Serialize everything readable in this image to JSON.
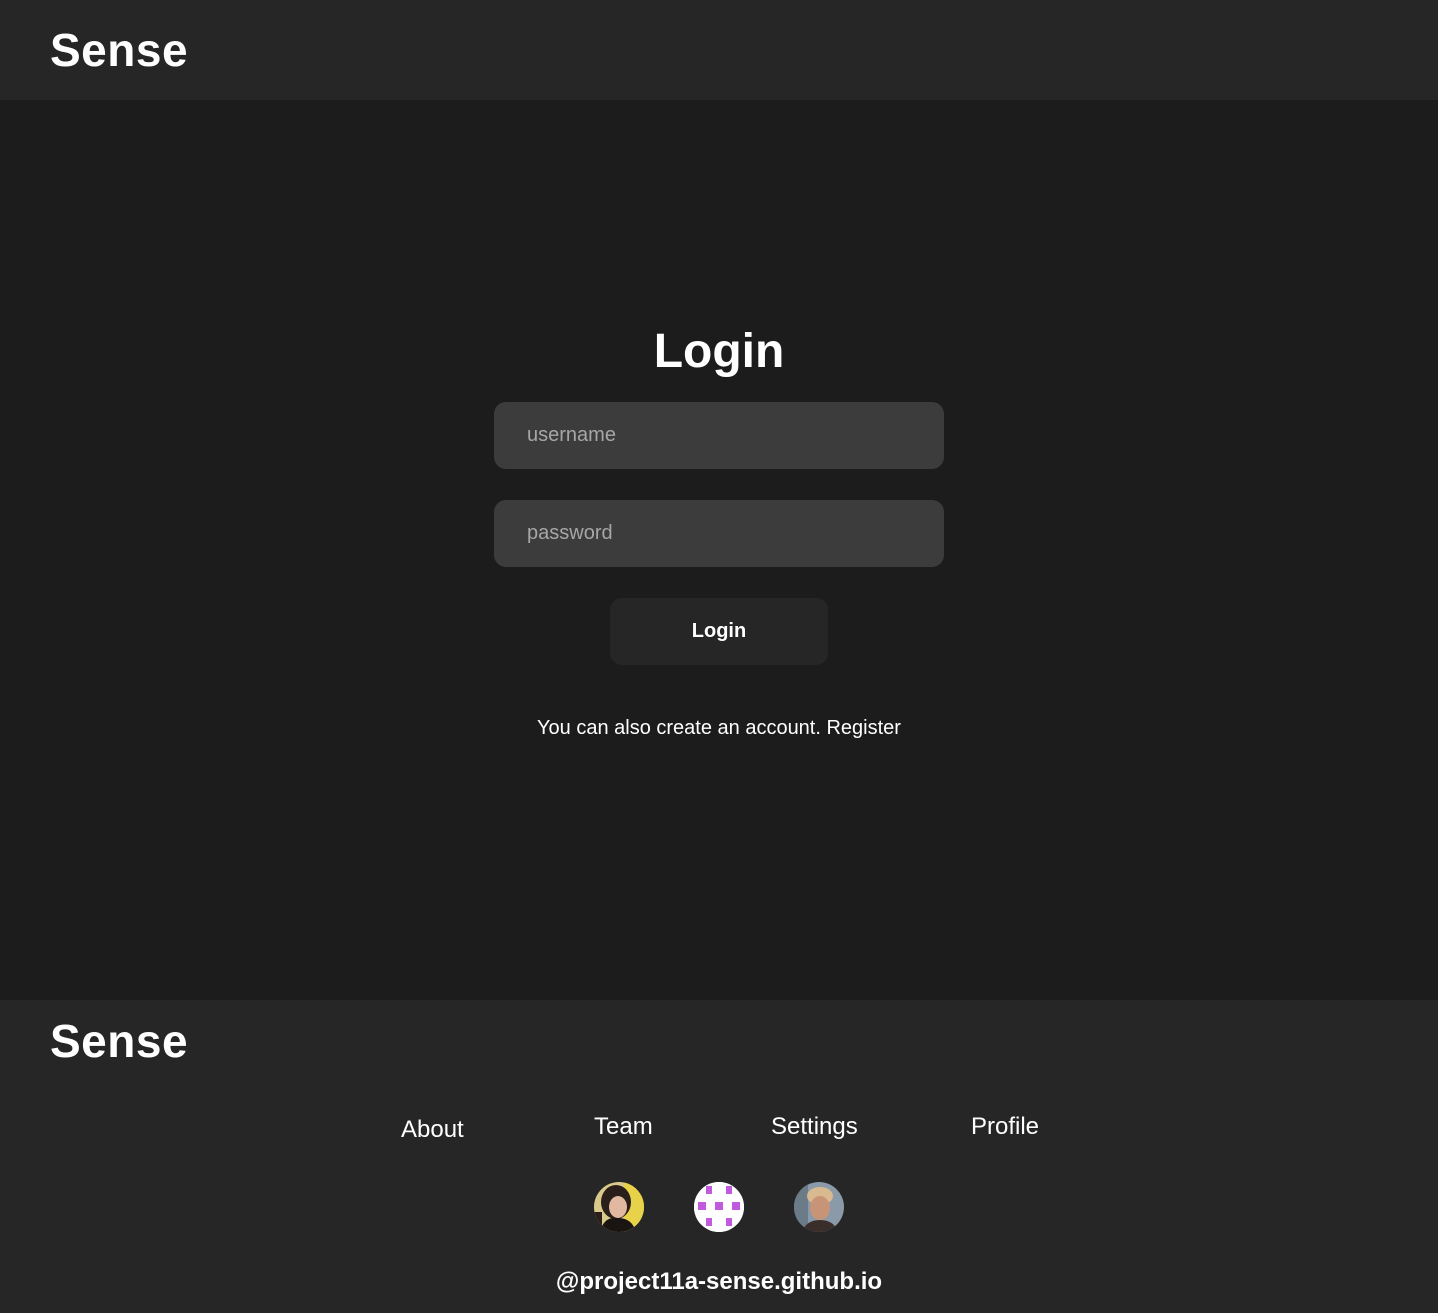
{
  "header": {
    "brand": "Sense"
  },
  "login": {
    "title": "Login",
    "username_placeholder": "username",
    "username_value": "",
    "password_placeholder": "password",
    "password_value": "",
    "submit_label": "Login",
    "register_prompt": "You can also create an account.",
    "register_link": "Register"
  },
  "footer": {
    "brand": "Sense",
    "nav": {
      "about": "About",
      "team": "Team",
      "settings": "Settings",
      "profile": "Profile"
    },
    "avatars": [
      "team-member-photo",
      "pattern-avatar-icon",
      "team-member-photo"
    ],
    "handle": "@project11a-sense.github.io"
  },
  "colors": {
    "page_bg": "#1c1c1c",
    "panel_bg": "#262626",
    "input_bg": "#3c3c3c",
    "text": "#ffffff",
    "placeholder": "#a6a6a6",
    "avatar_pattern": "#c05be0"
  }
}
